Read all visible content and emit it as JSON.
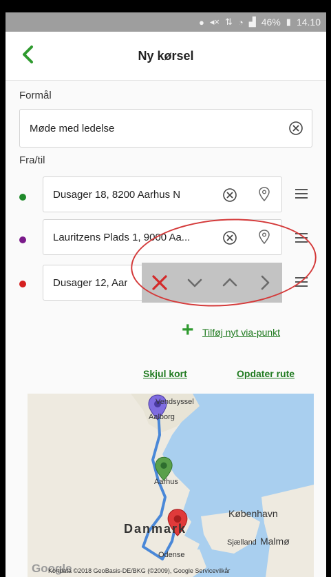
{
  "status_bar": {
    "battery": "46%",
    "time": "14.10",
    "icons": [
      "location-icon",
      "mute-icon",
      "network-icon",
      "wifi-icon",
      "signal-icon",
      "battery-icon"
    ]
  },
  "header": {
    "title": "Ny kørsel"
  },
  "form": {
    "purpose_label": "Formål",
    "purpose_value": "Møde med ledelse",
    "route_label": "Fra/til",
    "stops": [
      {
        "address": "Dusager 18, 8200 Aarhus N",
        "color": "#1f8a2a"
      },
      {
        "address": "Lauritzens Plads 1, 9000 Aa...",
        "color": "#7a1a8a"
      },
      {
        "address": "Dusager 12, Aar",
        "color": "#d52020"
      }
    ],
    "add_via_label": "Tilføj nyt via-punkt"
  },
  "actions": {
    "hide_map": "Skjul kort",
    "update_route": "Opdater rute"
  },
  "map": {
    "labels": {
      "vendsyssel": "Vendsyssel",
      "aalborg": "Aalborg",
      "aarhus": "Aarhus",
      "kobenhavn": "København",
      "danmark": "Danmark",
      "sjaelland": "Sjælland",
      "malmo": "Malmø",
      "odense": "Odense"
    },
    "credits": "Kortdata ©2018 GeoBasis-DE/BKG (©2009), Google   Servicevilkår",
    "google": "Google",
    "colors": {
      "water": "#a9cfef",
      "land": "#eeeae0",
      "route": "#4a88d8"
    }
  }
}
